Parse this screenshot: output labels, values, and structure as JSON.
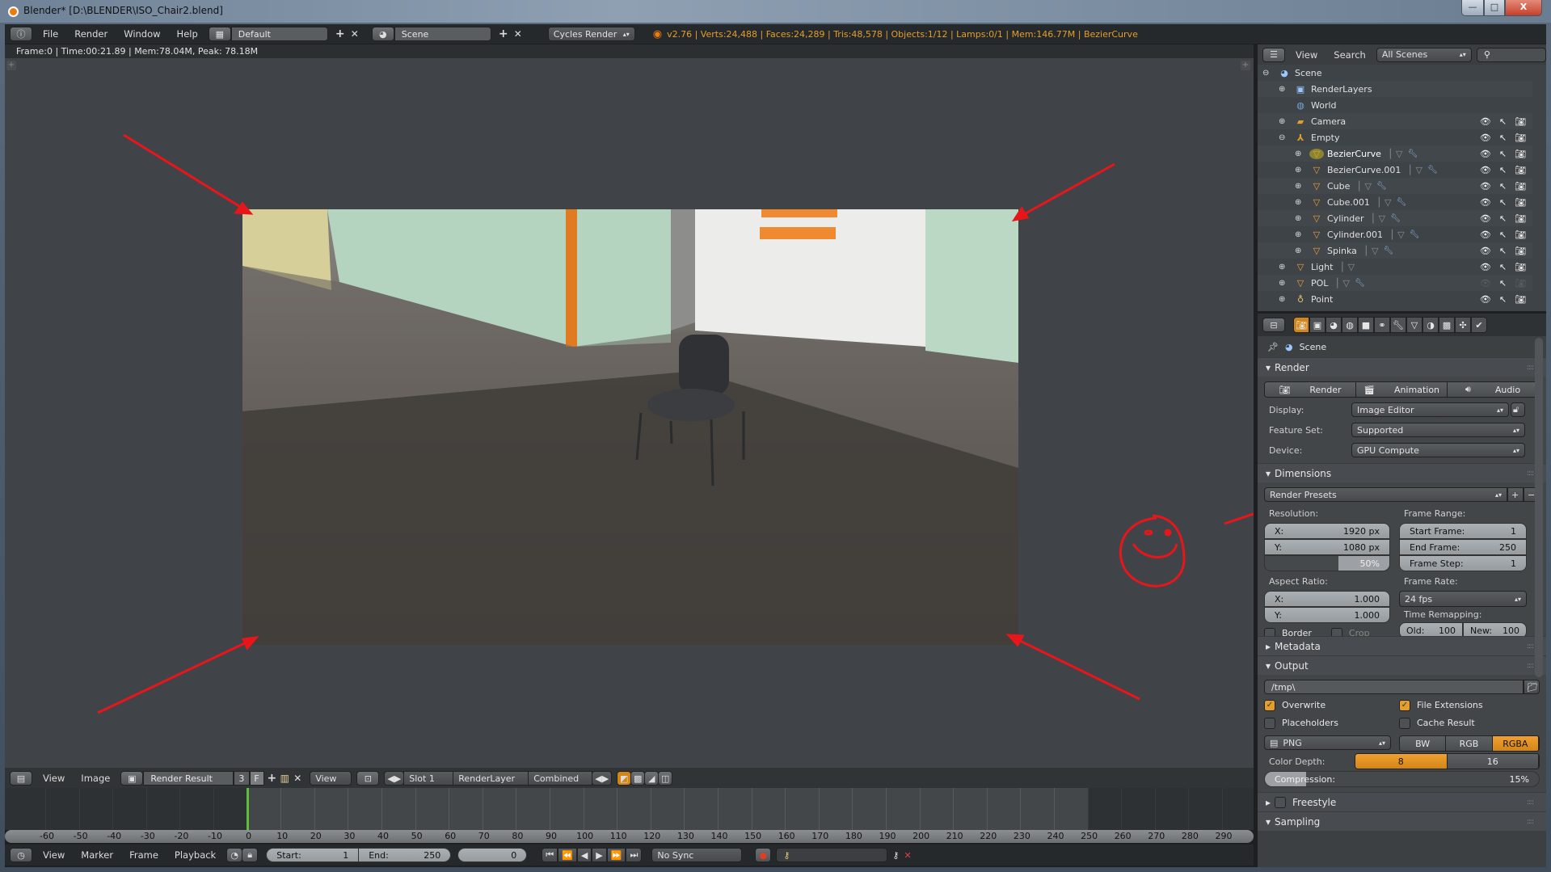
{
  "window": {
    "title": "Blender* [D:\\BLENDER\\ISO_Chair2.blend]",
    "controls": {
      "minimize": "—",
      "maximize": "□",
      "close": "X"
    }
  },
  "info_header": {
    "editor_icon": "info-icon",
    "menus": [
      "File",
      "Render",
      "Window",
      "Help"
    ],
    "screen_layout": "Default",
    "scene": "Scene",
    "render_engine": "Cycles Render",
    "stats": "v2.76 | Verts:24,488 | Faces:24,289 | Tris:48,578 | Objects:1/12 | Lamps:0/1 | Mem:146.77M | BezierCurve",
    "add_label": "+",
    "remove_label": "✕"
  },
  "image_editor": {
    "render_info": "Frame:0 | Time:00:21.89 | Mem:78.04M, Peak: 78.18M",
    "menus": [
      "View",
      "Image"
    ],
    "image_name": "Render Result",
    "users": "3",
    "fake_user": "F",
    "view_select": "View",
    "slot": "Slot 1",
    "render_layer": "RenderLayer",
    "pass": "Combined",
    "annotation_color": "#e8151a"
  },
  "timeline": {
    "ruler": [
      "-60",
      "-50",
      "-40",
      "-30",
      "-20",
      "-10",
      "0",
      "10",
      "20",
      "30",
      "40",
      "50",
      "60",
      "70",
      "80",
      "90",
      "100",
      "110",
      "120",
      "130",
      "140",
      "150",
      "160",
      "170",
      "180",
      "190",
      "200",
      "210",
      "220",
      "230",
      "240",
      "250",
      "260",
      "270",
      "280",
      "290"
    ],
    "current_frame_marker": 0,
    "range_end": 250,
    "menus": [
      "View",
      "Marker",
      "Frame",
      "Playback"
    ],
    "start_label": "Start:",
    "start_value": "1",
    "end_label": "End:",
    "end_value": "250",
    "current_frame": "0",
    "sync": "No Sync",
    "transport": [
      "⏮",
      "⏪",
      "◀",
      "▶",
      "⏩",
      "⏭"
    ]
  },
  "outliner": {
    "menus": [
      "View",
      "Search"
    ],
    "display_mode": "All Scenes",
    "items": [
      {
        "name": "Scene",
        "depth": 0,
        "icon": "scene-icon",
        "expanded": true
      },
      {
        "name": "RenderLayers",
        "depth": 1,
        "icon": "renderlayers-icon"
      },
      {
        "name": "World",
        "depth": 1,
        "icon": "world-icon"
      },
      {
        "name": "Camera",
        "depth": 1,
        "icon": "camera-icon",
        "visible": true
      },
      {
        "name": "Empty",
        "depth": 1,
        "icon": "empty-icon",
        "expanded": true,
        "visible": true
      },
      {
        "name": "BezierCurve",
        "depth": 2,
        "icon": "mesh-icon",
        "visible": true,
        "active": true
      },
      {
        "name": "BezierCurve.001",
        "depth": 2,
        "icon": "mesh-icon",
        "visible": true
      },
      {
        "name": "Cube",
        "depth": 2,
        "icon": "mesh-icon",
        "visible": true
      },
      {
        "name": "Cube.001",
        "depth": 2,
        "icon": "mesh-icon",
        "visible": true
      },
      {
        "name": "Cylinder",
        "depth": 2,
        "icon": "mesh-icon",
        "visible": true
      },
      {
        "name": "Cylinder.001",
        "depth": 2,
        "icon": "mesh-icon",
        "visible": true
      },
      {
        "name": "Spinka",
        "depth": 2,
        "icon": "mesh-icon",
        "visible": true
      },
      {
        "name": "Light",
        "depth": 1,
        "icon": "mesh-icon",
        "visible": true
      },
      {
        "name": "POL",
        "depth": 1,
        "icon": "mesh-icon",
        "visible": false
      },
      {
        "name": "Point",
        "depth": 1,
        "icon": "lamp-icon",
        "visible": true
      }
    ]
  },
  "properties": {
    "tabs": [
      "render",
      "render-layers",
      "scene",
      "world",
      "object",
      "constraints",
      "modifiers",
      "data",
      "material",
      "texture",
      "particles",
      "physics"
    ],
    "context": "Scene",
    "render": {
      "title": "Render",
      "buttons": [
        "Render",
        "Animation",
        "Audio"
      ],
      "display_label": "Display:",
      "display": "Image Editor",
      "feature_set_label": "Feature Set:",
      "feature_set": "Supported",
      "device_label": "Device:",
      "device": "GPU Compute"
    },
    "dimensions": {
      "title": "Dimensions",
      "presets": "Render Presets",
      "resolution_label": "Resolution:",
      "res_x_label": "X:",
      "res_x": "1920 px",
      "res_y_label": "Y:",
      "res_y": "1080 px",
      "res_percent": "50%",
      "res_percent_value": 0.5,
      "aspect_label": "Aspect Ratio:",
      "aspect_x_label": "X:",
      "aspect_x": "1.000",
      "aspect_y_label": "Y:",
      "aspect_y": "1.000",
      "border": "Border",
      "crop": "Crop",
      "frame_range_label": "Frame Range:",
      "start_frame_label": "Start Frame:",
      "start_frame": "1",
      "end_frame_label": "End Frame:",
      "end_frame": "250",
      "frame_step_label": "Frame Step:",
      "frame_step": "1",
      "frame_rate_label": "Frame Rate:",
      "frame_rate": "24 fps",
      "time_remap_label": "Time Remapping:",
      "old_label": "Old:",
      "old": "100",
      "new_label": "New:",
      "new": "100"
    },
    "metadata": {
      "title": "Metadata"
    },
    "output": {
      "title": "Output",
      "path": "/tmp\\",
      "overwrite": "Overwrite",
      "overwrite_checked": true,
      "file_extensions": "File Extensions",
      "file_extensions_checked": true,
      "placeholders": "Placeholders",
      "placeholders_checked": false,
      "cache_result": "Cache Result",
      "cache_result_checked": false,
      "format": "PNG",
      "color_modes": [
        "BW",
        "RGB",
        "RGBA"
      ],
      "color_mode_selected": "RGBA",
      "color_depth_label": "Color Depth:",
      "color_depths": [
        "8",
        "16"
      ],
      "color_depth_selected": "8",
      "compression_label": "Compression:",
      "compression": "15%",
      "compression_value": 0.15
    },
    "freestyle": {
      "title": "Freestyle"
    },
    "sampling": {
      "title": "Sampling"
    },
    "accent": "#e39e2c"
  }
}
